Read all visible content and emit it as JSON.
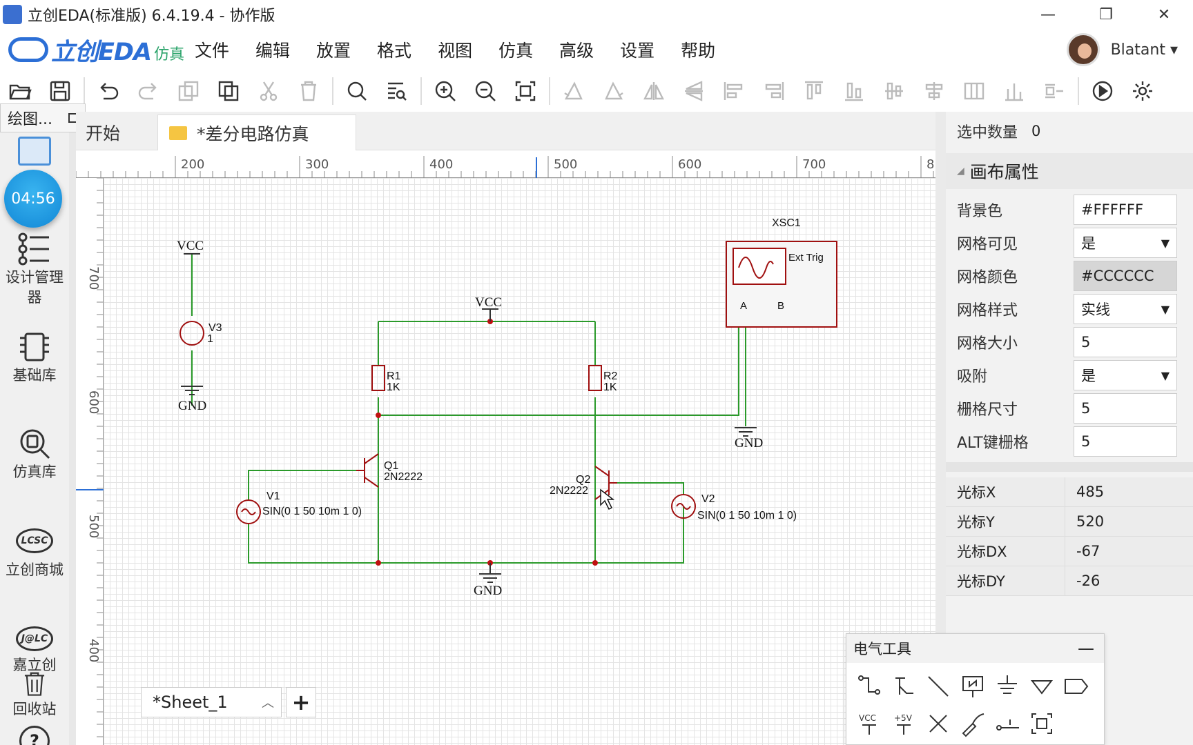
{
  "window": {
    "title": "立创EDA(标准版) 6.4.19.4 - 协作版",
    "minimize": "—",
    "restore": "❐",
    "close": "✕"
  },
  "logo": {
    "main": "立创EDA",
    "sub": "仿真"
  },
  "menu": [
    "文件",
    "编辑",
    "放置",
    "格式",
    "视图",
    "仿真",
    "高级",
    "设置",
    "帮助"
  ],
  "user": {
    "name": "Blatant ▾"
  },
  "toolbar": [
    "open-icon",
    "save-icon",
    "|",
    "undo-icon",
    "redo-icon",
    "copy-icon",
    "paste-icon",
    "cut-icon",
    "delete-icon",
    "|",
    "search-icon",
    "find-icon",
    "|",
    "zoom-in-icon",
    "zoom-out-icon",
    "fit-icon",
    "|",
    "align-1-icon",
    "align-2-icon",
    "flip-h-icon",
    "flip-v-icon",
    "align-left-icon",
    "align-right-icon",
    "align-top-icon",
    "align-bottom-icon",
    "align-center-h-icon",
    "align-center-v-icon",
    "distribute-h-icon",
    "distribute-v-icon",
    "grid-snap-icon",
    "|",
    "run-icon",
    "gear-icon"
  ],
  "sidebar": {
    "tooltip": "绘图...",
    "clock": "04:56",
    "items": [
      {
        "label": "设计管理器",
        "icon": "design-manager-icon"
      },
      {
        "label": "基础库",
        "icon": "basic-library-icon"
      },
      {
        "label": "仿真库",
        "icon": "sim-library-icon"
      },
      {
        "label": "立创商城",
        "icon": "lcsc-icon",
        "badge": "LCSC"
      },
      {
        "label": "嘉立创",
        "icon": "jlc-icon",
        "badge": "J@LC"
      },
      {
        "label": "回收站",
        "icon": "trash-icon"
      },
      {
        "label": "?",
        "icon": "help-icon"
      }
    ]
  },
  "tabs": [
    {
      "label": "开始"
    },
    {
      "label": "*差分电路仿真"
    }
  ],
  "ruler": {
    "h": [
      "200",
      "300",
      "400",
      "500",
      "600",
      "700",
      "8"
    ],
    "v": [
      "700",
      "600",
      "500",
      "400"
    ]
  },
  "schematic": {
    "labels": {
      "vcc_left": "VCC",
      "gnd_left": "GND",
      "v3": "V3",
      "v3_val": "1",
      "vcc_top": "VCC",
      "r1": "R1",
      "r1_val": "1K",
      "r2": "R2",
      "r2_val": "1K",
      "q1": "Q1",
      "q1_val": "2N2222",
      "q2": "Q2",
      "q2_val": "2N2222",
      "v1": "V1",
      "v1_val": "SIN(0 1 50 10m 1 0)",
      "v2": "V2",
      "v2_val": "SIN(0 1 50 10m 1 0)",
      "gnd_mid": "GND",
      "gnd_scope": "GND",
      "xsc": "XSC1",
      "ext_trig": "Ext Trig",
      "ch_a": "A",
      "ch_b": "B"
    }
  },
  "sheet": {
    "name": "*Sheet_1",
    "add": "+"
  },
  "props": {
    "selected_label": "选中数量",
    "selected_value": "0",
    "section": "画布属性",
    "rows": [
      {
        "label": "背景色",
        "value": "#FFFFFF",
        "type": "input"
      },
      {
        "label": "网格可见",
        "value": "是",
        "type": "select"
      },
      {
        "label": "网格颜色",
        "value": "#CCCCCC",
        "type": "color"
      },
      {
        "label": "网格样式",
        "value": "实线",
        "type": "select"
      },
      {
        "label": "网格大小",
        "value": "5",
        "type": "input"
      },
      {
        "label": "吸附",
        "value": "是",
        "type": "select"
      },
      {
        "label": "栅格尺寸",
        "value": "5",
        "type": "input"
      },
      {
        "label": "ALT键栅格",
        "value": "5",
        "type": "input"
      }
    ],
    "cursor": [
      {
        "label": "光标X",
        "value": "485"
      },
      {
        "label": "光标Y",
        "value": "520"
      },
      {
        "label": "光标DX",
        "value": "-67"
      },
      {
        "label": "光标DY",
        "value": "-26"
      }
    ]
  },
  "electrical_tools": {
    "title": "电气工具",
    "minimize": "—"
  },
  "colors": {
    "wire": "#2a9a2a",
    "component": "#a01010",
    "junction": "#c01010",
    "accent": "#2c6fd6"
  }
}
